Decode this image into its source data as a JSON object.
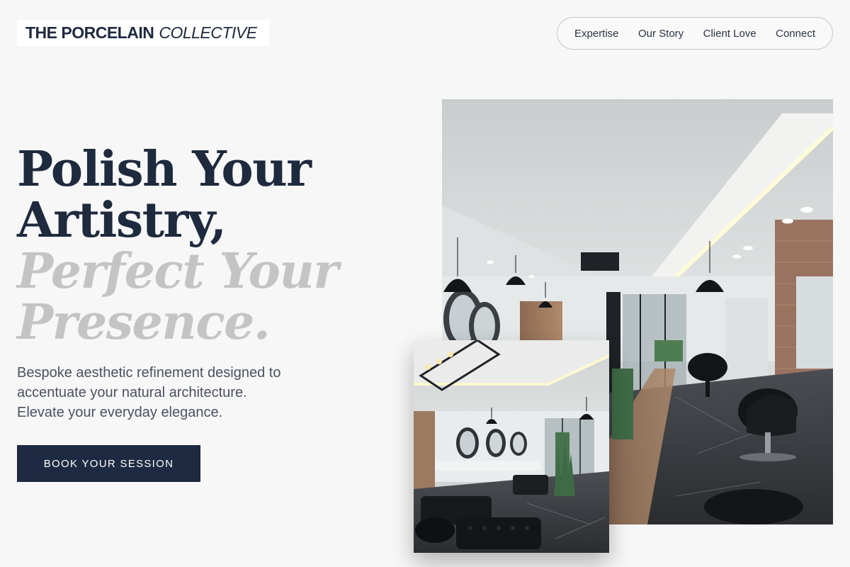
{
  "brand": {
    "name_bold": "THE PORCELAIN",
    "name_light": "COLLECTIVE"
  },
  "nav": {
    "items": [
      {
        "label": "Expertise"
      },
      {
        "label": "Our Story"
      },
      {
        "label": "Client Love"
      },
      {
        "label": "Connect"
      }
    ]
  },
  "hero": {
    "headline_lines": [
      "Polish Your",
      "Artistry,"
    ],
    "headline_italic_lines": [
      "Perfect Your",
      "Presence."
    ],
    "subtext_lines": [
      "Bespoke aesthetic refinement designed to",
      "accentuate your natural architecture.",
      "Elevate your everyday elegance."
    ],
    "cta_label": "BOOK YOUR SESSION"
  },
  "images": {
    "main": {
      "subject": "salon interior with black styling chairs, pendant lamps and marble floor"
    },
    "secondary": {
      "subject": "salon interior with round mirrors, wash stations and black sofa"
    }
  },
  "colors": {
    "background": "#f7f7f7",
    "primary_navy": "#1e2a42",
    "muted_italic": "#c4c4c4",
    "body_text": "#4a5160"
  }
}
